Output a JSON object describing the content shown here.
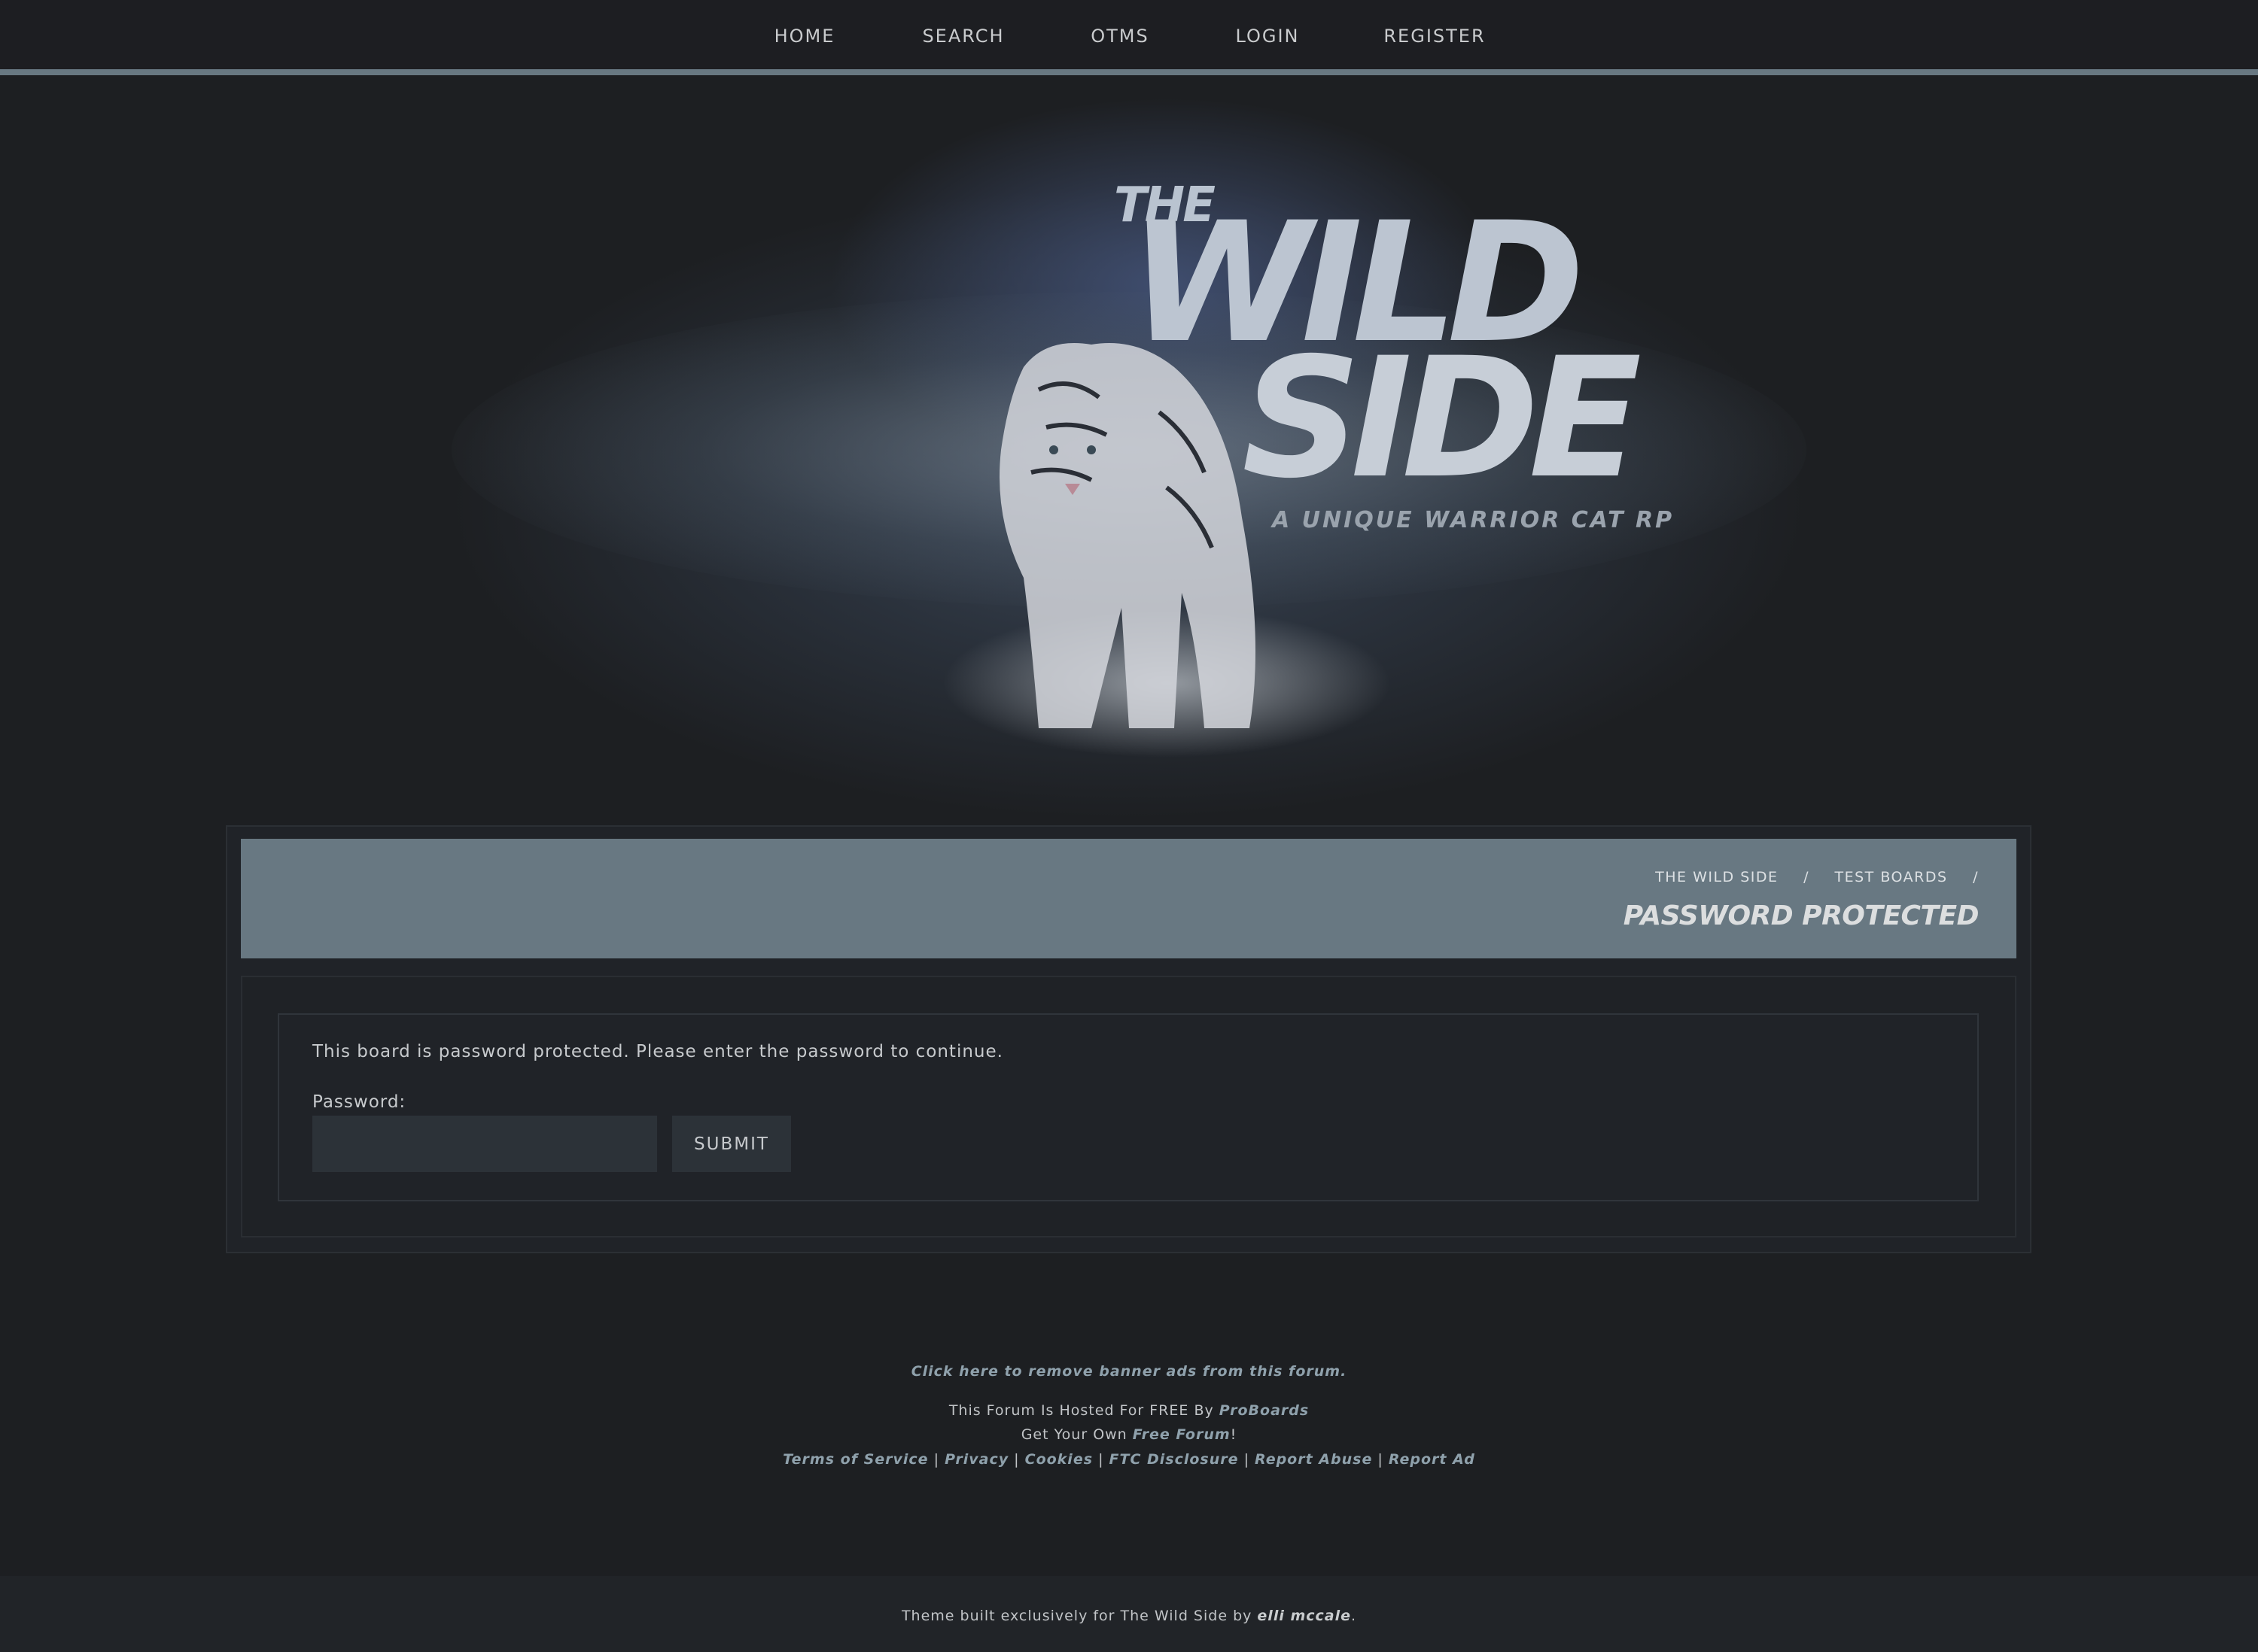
{
  "nav": {
    "items": [
      "HOME",
      "SEARCH",
      "OTMS",
      "LOGIN",
      "REGISTER"
    ]
  },
  "banner": {
    "logo_the": "THE",
    "logo_wild": "WILD",
    "logo_side": "SIDE",
    "logo_subtitle": "A UNIQUE WARRIOR CAT RP"
  },
  "header": {
    "breadcrumbs": [
      "THE WILD SIDE",
      "TEST BOARDS"
    ],
    "separator": "/",
    "title": "PASSWORD PROTECTED"
  },
  "form": {
    "message": "This board is password protected. Please enter the password to continue.",
    "password_label": "Password:",
    "password_value": "",
    "submit_label": "SUBMIT"
  },
  "footer": {
    "remove_ads": "Click here to remove banner ads from this forum.",
    "hosted_text": "This Forum Is Hosted For FREE By ",
    "hosted_link": "ProBoards",
    "own_text": "Get Your Own ",
    "own_link": "Free Forum",
    "own_suffix": "!",
    "links": [
      "Terms of Service",
      "Privacy",
      "Cookies",
      "FTC Disclosure",
      "Report Abuse",
      "Report Ad"
    ],
    "link_separator": " | "
  },
  "bottom": {
    "text": "Theme built exclusively for The Wild Side by ",
    "author": "elli mccale",
    "suffix": "."
  },
  "colors": {
    "accent": "#687882",
    "link": "#8fa1ac",
    "background": "#1d1f22"
  }
}
